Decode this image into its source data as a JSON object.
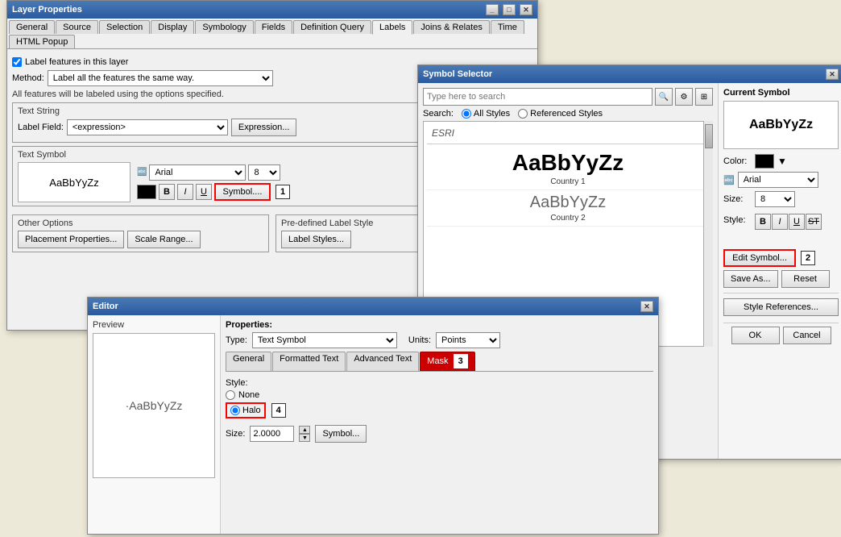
{
  "layerProps": {
    "title": "Layer Properties",
    "tabs": [
      "General",
      "Source",
      "Selection",
      "Display",
      "Symbology",
      "Fields",
      "Definition Query",
      "Labels",
      "Joins & Relates",
      "Time",
      "HTML Popup"
    ],
    "activeTab": "Labels",
    "checkboxLabel": "Label features in this layer",
    "methodLabel": "Method:",
    "methodValue": "Label all the features the same way.",
    "infoText": "All features will be labeled using the options specified.",
    "textStringLabel": "Text String",
    "labelFieldLabel": "Label Field:",
    "labelFieldValue": "<expression>",
    "expressionBtn": "Expression...",
    "textSymbolLabel": "Text Symbol",
    "textPreview": "AaBbYyZz",
    "fontName": "Arial",
    "fontSize": "8",
    "boldBtn": "B",
    "italicBtn": "I",
    "underlineBtn": "U",
    "symbolBtn": "Symbol....",
    "otherOptionsLabel": "Other Options",
    "placementBtn": "Placement Properties...",
    "scaleRangeBtn": "Scale Range...",
    "preLabelStyleLabel": "Pre-defined Label Style",
    "labelStylesBtn": "Label Styles..."
  },
  "symbolSelector": {
    "title": "Symbol Selector",
    "closeBtnLabel": "✕",
    "searchPlaceholder": "Type here to search",
    "searchLabel": "Search:",
    "allStylesLabel": "All Styles",
    "referencedStylesLabel": "Referenced Styles",
    "esriLabel": "ESRI",
    "items": [
      {
        "preview": "AaBbYyZz",
        "label": "Country 1",
        "bold": true
      },
      {
        "preview": "AaBbYyZz",
        "label": "Country 2",
        "bold": false
      }
    ],
    "currentSymbolTitle": "Current Symbol",
    "currentSymbolPreview": "AaBbYyZz",
    "colorLabel": "Color:",
    "fontLabel": "Arial",
    "sizeLabel": "Size:",
    "sizeValue": "8",
    "styleLabel": "Style:",
    "editSymbolBtn": "Edit Symbol...",
    "saveAsBtn": "Save As...",
    "resetBtn": "Reset",
    "styleReferencesBtn": "Style References...",
    "okBtn": "OK",
    "cancelBtn": "Cancel"
  },
  "editor": {
    "title": "Editor",
    "closeBtnLabel": "✕",
    "previewTitle": "Preview",
    "previewText": "·AaBbYyZz",
    "propertiesLabel": "Properties:",
    "typeLabel": "Type:",
    "typeValue": "Text Symbol",
    "unitsLabel": "Units:",
    "unitsValue": "Points",
    "tabs": [
      "General",
      "Formatted Text",
      "Advanced Text",
      "Mask"
    ],
    "activeTab": "Mask",
    "maskStyleLabel": "Style:",
    "noneLabel": "None",
    "haloLabel": "Halo",
    "sizeLabel": "Size:",
    "sizeValue": "2.0000",
    "symbolBtn": "Symbol..."
  },
  "stepBadges": [
    "1",
    "2",
    "3",
    "4"
  ]
}
